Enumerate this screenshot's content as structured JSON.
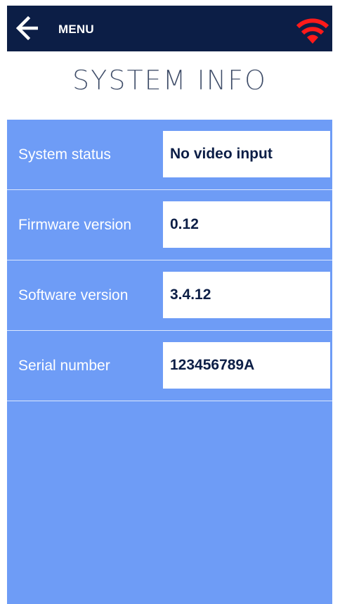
{
  "header": {
    "back_icon": "arrow-left-icon",
    "menu_label": "MENU",
    "wifi_icon": "wifi-icon",
    "wifi_color": "#ff1a1a",
    "bar_color": "#0c1e46"
  },
  "page": {
    "title": "SYSTEM INFO"
  },
  "info_rows": [
    {
      "label": "System status",
      "value": "No video input"
    },
    {
      "label": "Firmware version",
      "value": "0.12"
    },
    {
      "label": "Software version",
      "value": "3.4.12"
    },
    {
      "label": "Serial number",
      "value": "123456789A"
    }
  ],
  "colors": {
    "panel": "#6e9cf6",
    "title": "#3c4a66"
  }
}
